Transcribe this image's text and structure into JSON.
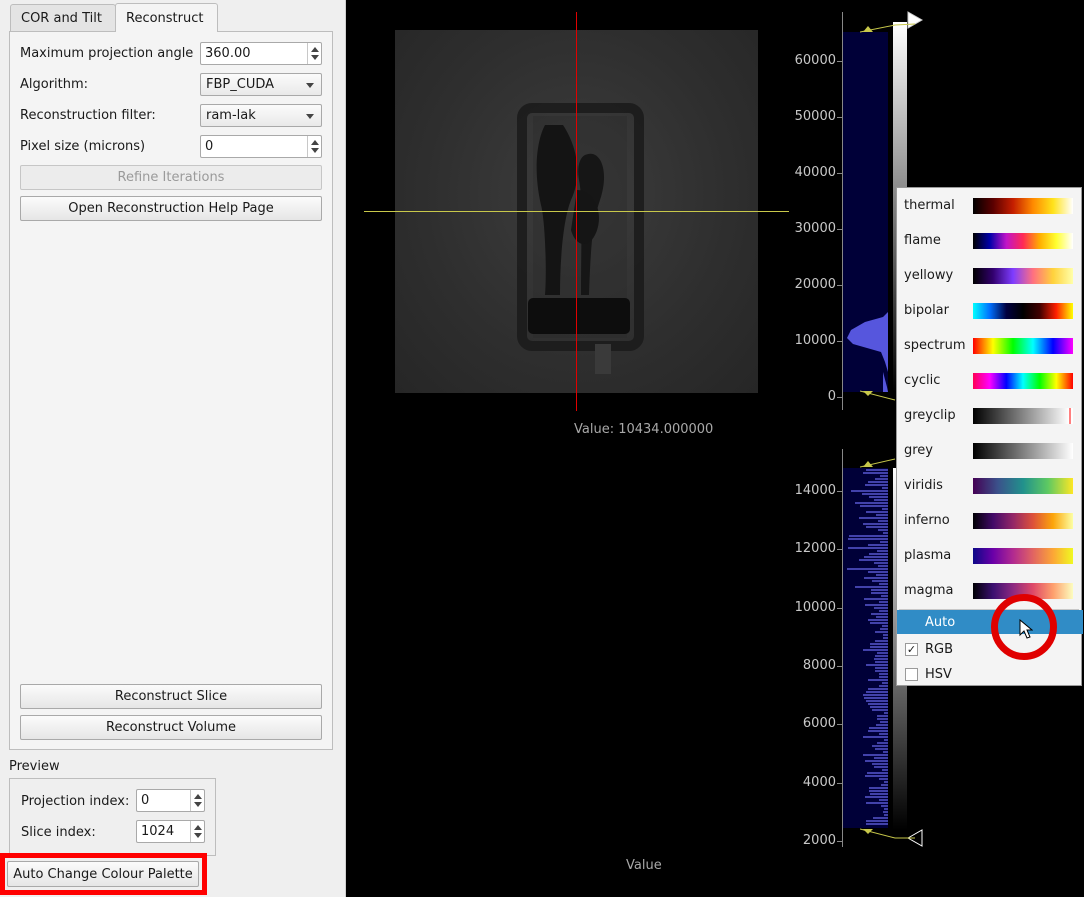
{
  "tabs": [
    {
      "label": "COR and Tilt",
      "active": false
    },
    {
      "label": "Reconstruct",
      "active": true
    }
  ],
  "form": {
    "max_angle_label": "Maximum projection angle",
    "max_angle_value": "360.00",
    "algorithm_label": "Algorithm:",
    "algorithm_value": "FBP_CUDA",
    "filter_label": "Reconstruction filter:",
    "filter_value": "ram-lak",
    "pixel_size_label": "Pixel size (microns)",
    "pixel_size_value": "0",
    "refine_label": "Refine Iterations",
    "help_label": "Open Reconstruction Help Page",
    "recon_slice_label": "Reconstruct Slice",
    "recon_volume_label": "Reconstruct Volume"
  },
  "preview": {
    "title": "Preview",
    "projection_label": "Projection index:",
    "projection_value": "0",
    "slice_label": "Slice index:",
    "slice_value": "1024"
  },
  "auto_change_label": "Auto Change Colour Palette",
  "viewer": {
    "value_readout": "Value: 10434.000000",
    "bottom_axis_label": "Value"
  },
  "hist_top_ticks": [
    "60000",
    "50000",
    "40000",
    "30000",
    "20000",
    "10000",
    "0"
  ],
  "hist_bottom_ticks": [
    "14000",
    "12000",
    "10000",
    "8000",
    "6000",
    "4000",
    "2000"
  ],
  "colour_menu": {
    "items": [
      {
        "name": "thermal"
      },
      {
        "name": "flame"
      },
      {
        "name": "yellowy"
      },
      {
        "name": "bipolar"
      },
      {
        "name": "spectrum"
      },
      {
        "name": "cyclic"
      },
      {
        "name": "greyclip"
      },
      {
        "name": "grey"
      },
      {
        "name": "viridis"
      },
      {
        "name": "inferno"
      },
      {
        "name": "plasma"
      },
      {
        "name": "magma"
      }
    ],
    "auto_label": "Auto",
    "rgb_label": "RGB",
    "rgb_checked": true,
    "hsv_label": "HSV",
    "hsv_checked": false
  }
}
